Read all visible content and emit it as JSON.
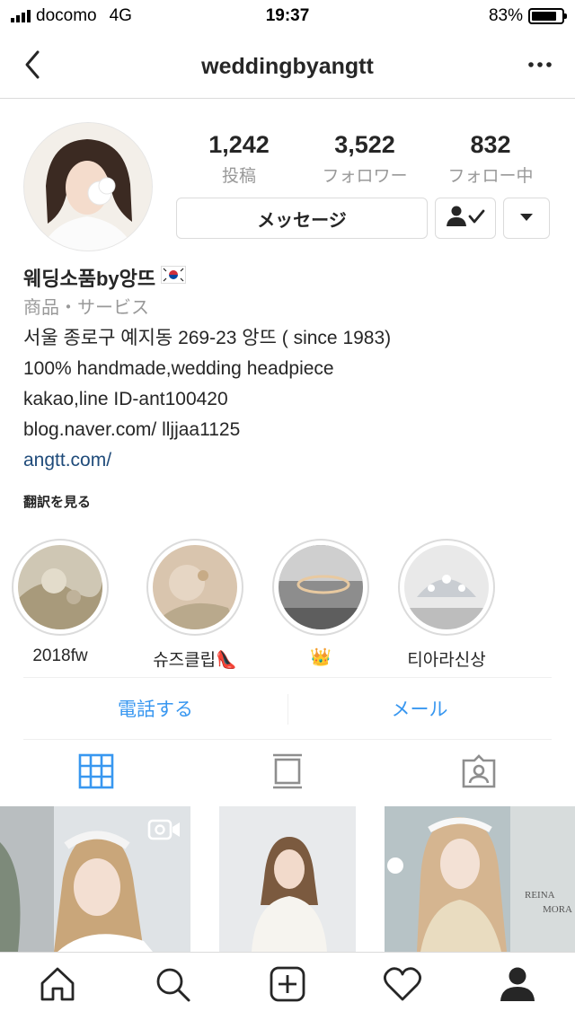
{
  "status_bar": {
    "carrier": "docomo",
    "network": "4G",
    "time": "19:37",
    "battery": "83%",
    "battery_level": 0.83
  },
  "nav": {
    "username": "weddingbyangtt",
    "back_icon": "chevron-left-icon",
    "more_icon": "more-dots-icon"
  },
  "profile": {
    "stats": [
      {
        "value": "1,242",
        "label": "投稿"
      },
      {
        "value": "3,522",
        "label": "フォロワー"
      },
      {
        "value": "832",
        "label": "フォロー中"
      }
    ],
    "message_button": "メッセージ",
    "follow_icon": "following-check-icon",
    "dropdown_icon": "caret-down-icon",
    "display_name": "웨딩소품by앙뜨",
    "flag_icon": "korea-flag-icon",
    "category": "商品・サービス",
    "bio_lines": [
      "서울 종로구 예지동 269-23 앙뜨 ( since 1983)",
      "100% handmade,wedding headpiece",
      "kakao,line ID-ant100420",
      "blog.naver.com/ lljjaa1125"
    ],
    "website": "angtt.com/",
    "translate": "翻訳を見る"
  },
  "highlights": [
    {
      "label": "2018fw"
    },
    {
      "label": "슈즈클립👠"
    },
    {
      "label": "👑"
    },
    {
      "label": "티아라신상"
    }
  ],
  "contact": {
    "call": "電話する",
    "email": "メール"
  },
  "colors": {
    "link_blue": "#3897f0",
    "text_dark": "#262626",
    "text_gray": "#999999",
    "divider": "#dbdbdb"
  },
  "tabs": [
    "grid-icon",
    "feed-icon",
    "tagged-icon"
  ],
  "bottom_nav": [
    "home-icon",
    "search-icon",
    "new-post-icon",
    "activity-heart-icon",
    "profile-icon"
  ]
}
